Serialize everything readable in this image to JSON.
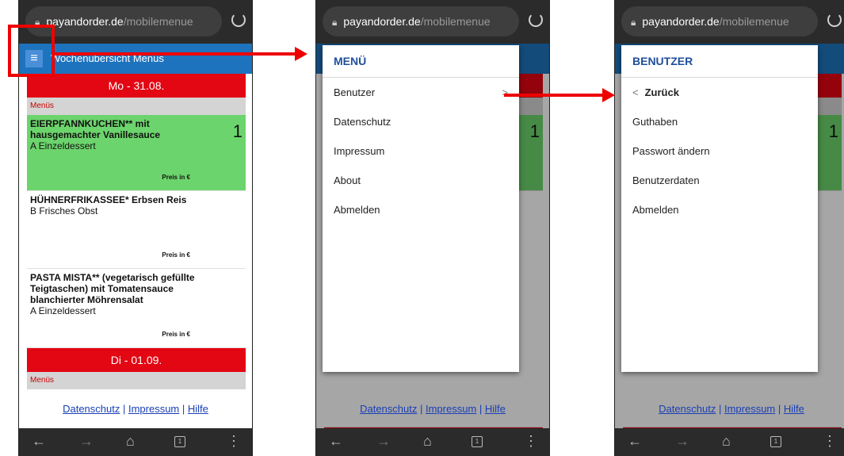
{
  "browser": {
    "domain": "payandorder.de",
    "path": "/mobilemenue"
  },
  "site": {
    "title": "Wochenübersicht Menüs",
    "burger": "≡"
  },
  "day1": {
    "label": "Mo - 31.08.",
    "section": "Menüs"
  },
  "dishes": [
    {
      "name": "EIERPFANNKUCHEN** mit hausgemachter Vanillesauce",
      "side": "A Einzeldessert",
      "price": "Preis in €",
      "count": "1"
    },
    {
      "name": "HÜHNERFRIKASSEE* Erbsen Reis",
      "side": "B Frisches Obst",
      "price": "Preis in €"
    },
    {
      "name": "PASTA MISTA** (vegetarisch gefüllte Teigtaschen) mit Tomatensauce blanchierter Möhrensalat",
      "side": "A Einzeldessert",
      "price": "Preis in €"
    }
  ],
  "day2": {
    "label": "Di - 01.09.",
    "section": "Menüs"
  },
  "footer": {
    "datenschutz": "Datenschutz",
    "impressum": "Impressum",
    "hilfe": "Hilfe",
    "sep": " | "
  },
  "menu": {
    "title": "MENÜ",
    "items": [
      "Benutzer",
      "Datenschutz",
      "Impressum",
      "About",
      "Abmelden"
    ],
    "chevron": ">"
  },
  "user": {
    "title": "BENUTZER",
    "back": "Zurück",
    "back_icon": "<",
    "items": [
      "Guthaben",
      "Passwort ändern",
      "Benutzerdaten",
      "Abmelden"
    ]
  },
  "second_screen_count": "1",
  "tabcount": "1",
  "colors": {
    "accent_blue": "#1e73be",
    "day_red": "#e30613",
    "selected_green": "#6cd46c",
    "annotation_red": "#ee0000"
  }
}
